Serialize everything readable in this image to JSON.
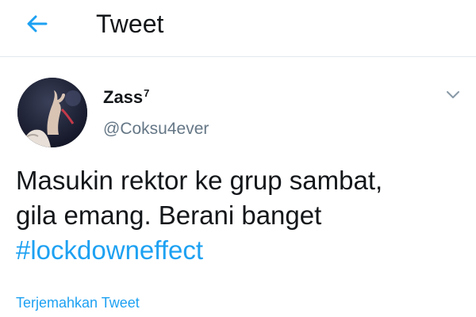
{
  "header": {
    "back_icon": "arrow-left-icon",
    "title": "Tweet"
  },
  "tweet": {
    "author": {
      "display_name": "Zass",
      "name_superscript": "7",
      "handle": "@Coksu4ever",
      "avatar": "user-avatar-photo"
    },
    "more_icon": "chevron-down-icon",
    "text_line_1": "Masukin rektor ke grup sambat,",
    "text_line_2": "gila emang. Berani banget",
    "hashtag": "#lockdowneffect",
    "translate_label": "Terjemahkan Tweet"
  },
  "colors": {
    "accent": "#1da1f2",
    "text_primary": "#14171a",
    "text_secondary": "#657786",
    "divider": "#e1e8ed"
  }
}
